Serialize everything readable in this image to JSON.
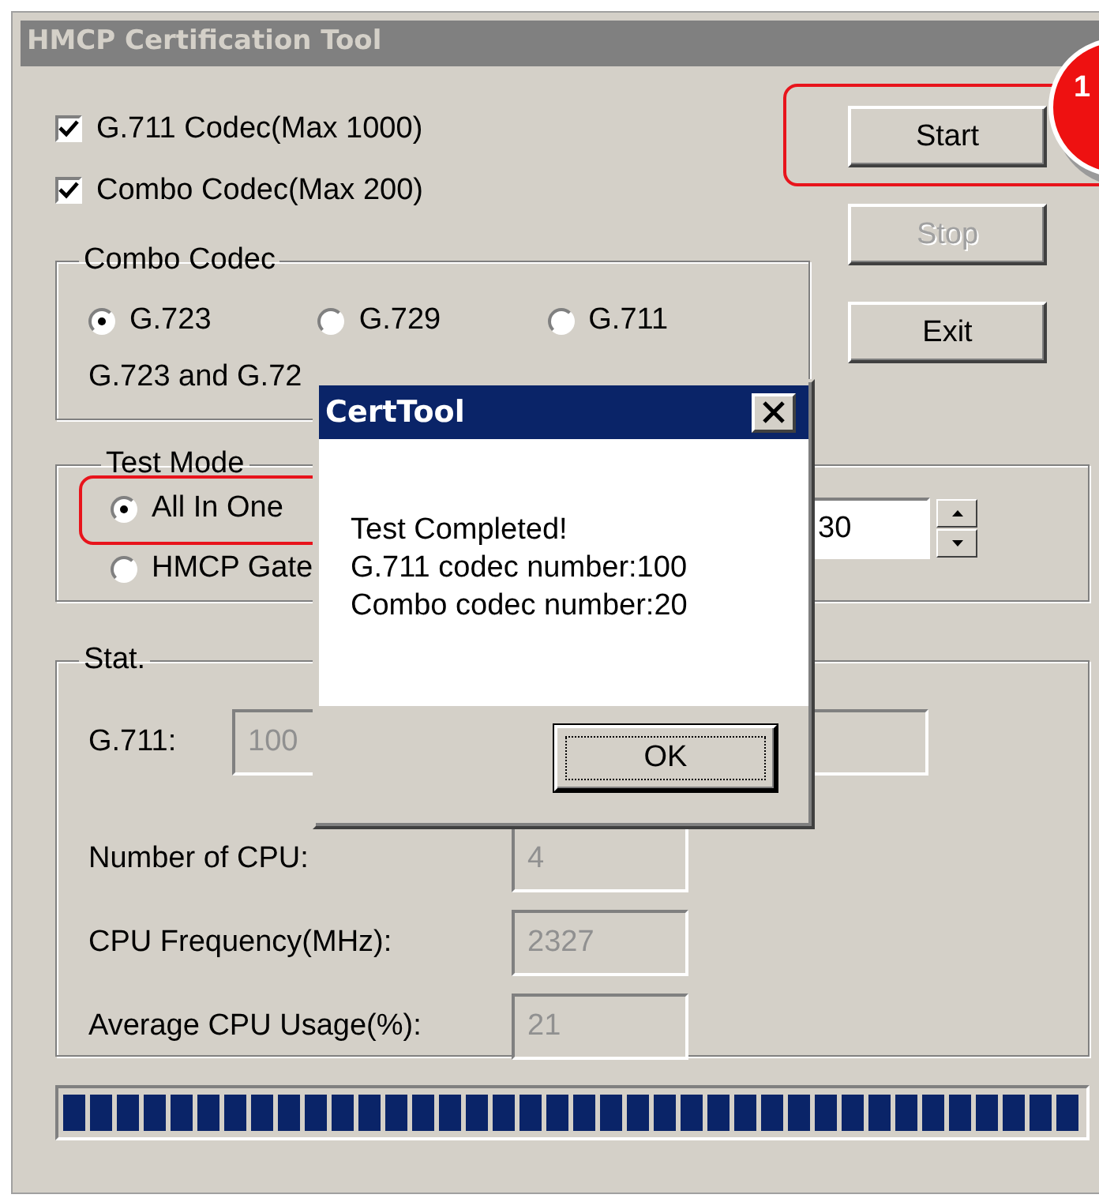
{
  "window": {
    "title": "HMCP Certification Tool"
  },
  "checkboxes": [
    {
      "label": "G.711 Codec(Max 1000)",
      "checked": true
    },
    {
      "label": "Combo Codec(Max 200)",
      "checked": true
    }
  ],
  "combo_codec": {
    "title": "Combo Codec",
    "options": [
      {
        "label": "G.723",
        "selected": true
      },
      {
        "label": "G.729",
        "selected": false
      },
      {
        "label": "G.711",
        "selected": false
      }
    ],
    "note": "G.723 and G.72"
  },
  "buttons": [
    {
      "label": "Start",
      "disabled": false,
      "highlighted": true
    },
    {
      "label": "Stop",
      "disabled": true,
      "highlighted": false
    },
    {
      "label": "Exit",
      "disabled": false,
      "highlighted": false
    }
  ],
  "test_mode": {
    "title": "Test Mode",
    "options": [
      {
        "label": "All In One",
        "selected": true,
        "highlighted": true
      },
      {
        "label": "HMCP Gate",
        "selected": false,
        "highlighted": false
      }
    ],
    "spin_value": "30"
  },
  "stat": {
    "title": "Stat.",
    "first": {
      "label": "G.711:",
      "value": "100"
    },
    "fields": [
      {
        "label": "Number of CPU:",
        "value": "4"
      },
      {
        "label": "CPU Frequency(MHz):",
        "value": "2327"
      },
      {
        "label": "Average CPU Usage(%):",
        "value": "21"
      }
    ]
  },
  "progress": {
    "level": 1
  },
  "dialog": {
    "title": "CertTool",
    "lines": [
      "Test Completed!",
      "G.711 codec number:100",
      "Combo codec number:20"
    ],
    "button": "OK"
  },
  "callout": {
    "number": "1"
  }
}
